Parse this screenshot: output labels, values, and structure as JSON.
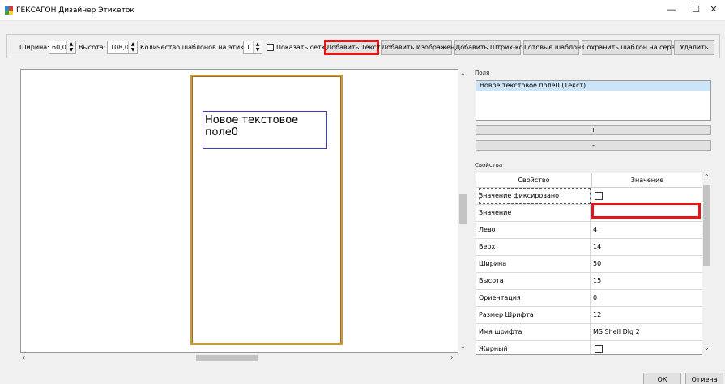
{
  "window": {
    "title": "ГЕКСАГОН Дизайнер Этикеток",
    "minimize": "—",
    "maximize": "☐",
    "close": "✕"
  },
  "toolbar": {
    "width_label": "Ширина:",
    "width_value": "60,0",
    "height_label": "Высота:",
    "height_value": "108,0",
    "count_label": "Количество шаблонов на этикетке:",
    "count_value": "1",
    "show_grid_label": "Показать сетку",
    "show_grid_checked": false,
    "add_text": "Добавить Текст",
    "add_image": "Добавить Изображение",
    "add_barcode": "Добавить Штрих-код",
    "ready_templates": "Готовые шаблоны",
    "save_server": "Сохранить шаблон на сервере",
    "delete": "Удалить"
  },
  "canvas": {
    "text_field_content": "Новое текстовое поле0"
  },
  "fields": {
    "title": "Поля",
    "items": [
      "Новое текстовое поле0 (Текст)"
    ],
    "add_button": "+",
    "remove_button": "-"
  },
  "properties": {
    "title": "Свойства",
    "col_property": "Свойство",
    "col_value": "Значение",
    "rows": [
      {
        "name": "Значение фиксировано",
        "value": "",
        "checkbox": true
      },
      {
        "name": "Значение",
        "value": "",
        "checkbox": false
      },
      {
        "name": "Лево",
        "value": "4",
        "checkbox": false
      },
      {
        "name": "Верх",
        "value": "14",
        "checkbox": false
      },
      {
        "name": "Ширина",
        "value": "50",
        "checkbox": false
      },
      {
        "name": "Высота",
        "value": "15",
        "checkbox": false
      },
      {
        "name": "Ориентация",
        "value": "0",
        "checkbox": false
      },
      {
        "name": "Размер Шрифта",
        "value": "12",
        "checkbox": false
      },
      {
        "name": "Имя шрифта",
        "value": "MS Shell Dlg 2",
        "checkbox": false
      },
      {
        "name": "Жирный",
        "value": "",
        "checkbox": true
      }
    ]
  },
  "footer": {
    "ok": "ОК",
    "cancel": "Отмена"
  },
  "colors": {
    "highlight": "#e01818",
    "label_border": "#c99a3c",
    "text_box_border": "#3d3dc6",
    "selection": "#cce4f7",
    "app_icon_blue": "#1e88e5",
    "app_icon_red": "#e53935",
    "app_icon_green": "#43a047",
    "app_icon_yellow": "#fdd835"
  }
}
